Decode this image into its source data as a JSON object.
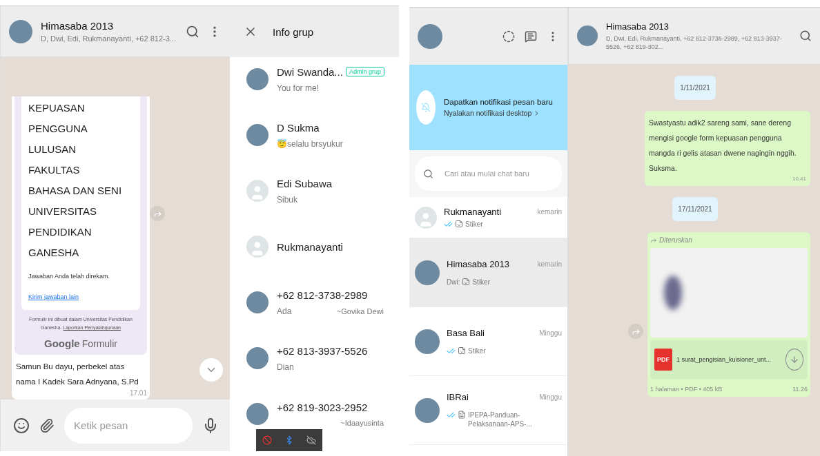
{
  "left": {
    "chat_header": {
      "title": "Himasaba 2013",
      "subtitle": "D, Dwi, Edi, Rukmanayanti, +62 812-3..."
    },
    "form_message": {
      "title": "KEPUASAN\nPENGGUNA\nLULUSAN\nFAKULTAS\nBAHASA DAN SENI\nUNIVERSITAS\nPENDIDIKAN\nGANESHA",
      "confirmation": "Jawaban Anda telah direkam.",
      "link": "Kirim jawaban lain",
      "footer": "Formulir ini dibuat dalam Universitas Pendidikan Ganesha.",
      "footer_link": "Laporkan Penyalahgunaan",
      "brand": "Google",
      "brand_product": "Formulir",
      "caption": "Samun Bu dayu, perbekel atas nama I Kadek Sara Adnyana, S.Pd",
      "time": "17.01"
    },
    "composer": {
      "placeholder": "Ketik pesan"
    },
    "info": {
      "title": "Info grup",
      "members": [
        {
          "name": "Dwi Swanda...",
          "status": "You for me!",
          "badge": "Admin grup",
          "has_photo": true
        },
        {
          "name": "D Sukma",
          "status": "😇selalu brsyukur",
          "has_photo": true
        },
        {
          "name": "Edi Subawa",
          "status": "Sibuk",
          "has_photo": false
        },
        {
          "name": "Rukmanayanti",
          "has_photo": false
        },
        {
          "name": "+62 812-3738-2989",
          "status": "Ada",
          "alias": "~Govika Dewi",
          "has_photo": true
        },
        {
          "name": "+62 813-3937-5526",
          "status": "Dian",
          "has_photo": true
        },
        {
          "name": "+62 819-3023-2952",
          "alias": "~Idaayusinta",
          "has_photo": true
        }
      ]
    }
  },
  "right": {
    "banner": {
      "title": "Dapatkan notifikasi pesan baru",
      "subtitle": "Nyalakan notifikasi desktop"
    },
    "search": {
      "placeholder": "Cari atau mulai chat baru"
    },
    "chats": [
      {
        "kind": "sticker",
        "name": "Rukmanayanti",
        "time": "kemarin",
        "preview": "Stiker",
        "ticks": true,
        "selected": false,
        "has_photo": false
      },
      {
        "kind": "sticker",
        "name": "Himasaba 2013",
        "time": "kemarin",
        "sender": "Dwi:",
        "preview": "Stiker",
        "ticks": false,
        "selected": true,
        "has_photo": true
      },
      {
        "kind": "sticker",
        "name": "Basa Bali",
        "time": "Minggu",
        "preview": "Stiker",
        "ticks": true,
        "selected": false,
        "has_photo": true
      },
      {
        "kind": "document",
        "name": "IBRai",
        "time": "Minggu",
        "preview": "IPEPA-Panduan-Pelaksanaan-APS-...",
        "ticks": true,
        "selected": false,
        "has_photo": true
      }
    ],
    "chat_header": {
      "title": "Himasaba 2013",
      "subtitle": "D, Dwi, Edi, Rukmanayanti, +62 812-3738-2989, +62 813-3937-5526, +62 819-302..."
    },
    "messages": [
      {
        "kind": "date",
        "text": "1/11/2021"
      },
      {
        "kind": "text",
        "text": "Swastyastu adik2 sareng sami, sane dereng mengisi google form kepuasan pengguna mangda ri gelis atasan dwene nagingin nggih. Suksma.",
        "time": "10.41"
      },
      {
        "kind": "date",
        "text": "17/11/2021"
      },
      {
        "kind": "document",
        "label": "Diteruskan",
        "file": "1 surat_pengisian_kuisioner_unt...",
        "meta": "1 halaman • PDF • 405 kB",
        "file_type": "PDF",
        "time": "11.26"
      }
    ]
  }
}
